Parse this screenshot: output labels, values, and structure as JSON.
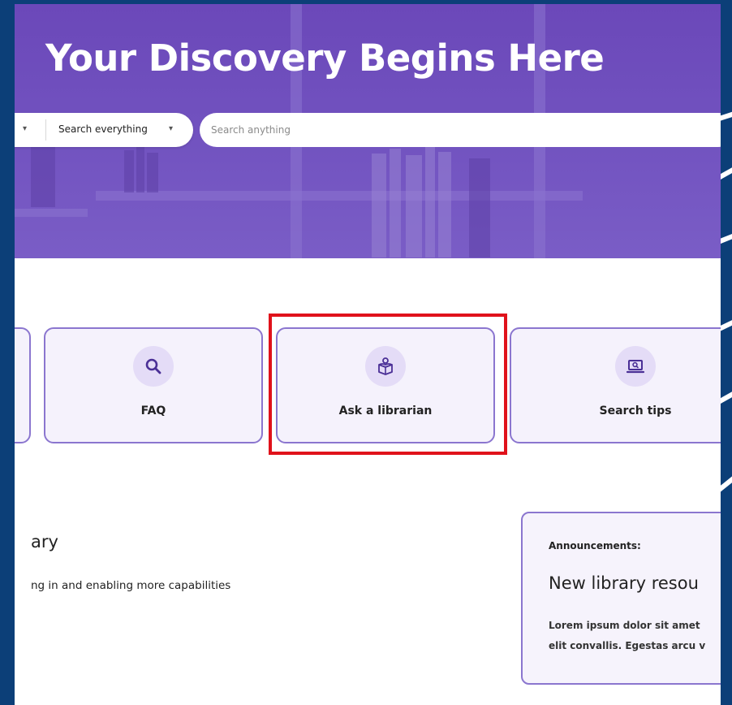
{
  "hero": {
    "title": "Your Discovery Begins Here",
    "scope_label": "Search everything",
    "search_placeholder": "Search anything"
  },
  "quick_links": [
    {
      "label": "FAQ",
      "icon": "search-icon"
    },
    {
      "label": "Ask a librarian",
      "icon": "librarian-book-icon"
    },
    {
      "label": "Search tips",
      "icon": "laptop-search-icon"
    }
  ],
  "about": {
    "title": "ary",
    "text": "ng in and enabling more capabilities"
  },
  "announcements": {
    "label": "Announcements:",
    "heading": "New library resou",
    "body_line1": "Lorem ipsum dolor sit amet",
    "body_line2": "elit convallis. Egestas arcu v"
  },
  "colors": {
    "frame": "#0c3f78",
    "hero": "#6b48b9",
    "card_border": "#8b76cf",
    "card_bg": "#f5f2fc",
    "highlight": "#e0121b",
    "icon_bg": "#e4dcf7",
    "icon_stroke": "#4a2f96"
  }
}
